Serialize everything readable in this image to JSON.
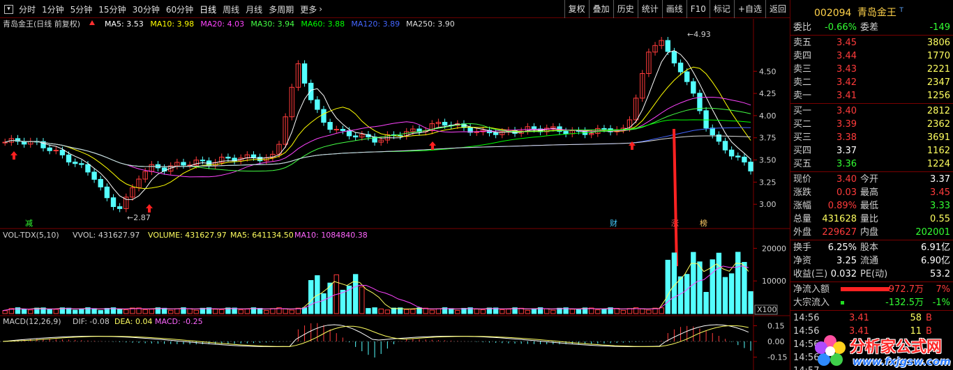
{
  "toolbar": {
    "periods": [
      "分时",
      "1分钟",
      "5分钟",
      "15分钟",
      "30分钟",
      "60分钟",
      "日线",
      "周线",
      "月线",
      "多周期",
      "更多"
    ],
    "active_period": "日线",
    "more_arrow": "chevron-right-icon",
    "right_buttons": [
      "复权",
      "叠加",
      "历史",
      "统计",
      "画线",
      "F10",
      "标记",
      "+自选",
      "返回"
    ]
  },
  "price_pane": {
    "title": "青岛金王(日线 前复权)",
    "ma": [
      {
        "label": "MA5: 3.53",
        "color": "#ffffff"
      },
      {
        "label": "MA10: 3.98",
        "color": "#ffff00"
      },
      {
        "label": "MA20: 4.03",
        "color": "#ff44ff"
      },
      {
        "label": "MA30: 3.94",
        "color": "#44ff44"
      },
      {
        "label": "MA60: 3.88",
        "color": "#00ff00"
      },
      {
        "label": "MA120: 3.89",
        "color": "#4466ff"
      },
      {
        "label": "MA250: 3.90",
        "color": "#dddddd"
      }
    ],
    "y_ticks": [
      "4.50",
      "4.25",
      "4.00",
      "3.75",
      "3.50",
      "3.25",
      "3.00"
    ],
    "high_label": "4.93",
    "low_label": "2.87",
    "markers": [
      "减",
      "财",
      "涨",
      "榜"
    ]
  },
  "vol_pane": {
    "title": "VOL-TDX(5,10)",
    "vvol": "VVOL: 431627.97",
    "volume": "VOLUME: 431627.97",
    "ma5": "MA5: 641134.50",
    "ma10": "MA10: 1084840.38",
    "y_ticks": [
      "20000",
      "10000"
    ],
    "unit": "X100"
  },
  "macd_pane": {
    "title": "MACD(12,26,9)",
    "dif": "DIF: -0.08",
    "dea": "DEA: 0.04",
    "macd": "MACD: -0.25",
    "y_ticks": [
      "0.15",
      "0.00",
      "-0.15"
    ]
  },
  "quote": {
    "code": "002094",
    "name": "青岛金王",
    "sup": "T",
    "weibi": {
      "label": "委比",
      "value": "-0.66%",
      "label2": "委差",
      "value2": "-149"
    },
    "asks": [
      {
        "label": "卖五",
        "price": "3.45",
        "vol": "3806"
      },
      {
        "label": "卖四",
        "price": "3.44",
        "vol": "1770"
      },
      {
        "label": "卖三",
        "price": "3.43",
        "vol": "2221"
      },
      {
        "label": "卖二",
        "price": "3.42",
        "vol": "2347"
      },
      {
        "label": "卖一",
        "price": "3.41",
        "vol": "1256"
      }
    ],
    "bids": [
      {
        "label": "买一",
        "price": "3.40",
        "vol": "2812",
        "color": "red"
      },
      {
        "label": "买二",
        "price": "3.39",
        "vol": "2362",
        "color": "red"
      },
      {
        "label": "买三",
        "price": "3.38",
        "vol": "3691",
        "color": "red"
      },
      {
        "label": "买四",
        "price": "3.37",
        "vol": "1162",
        "color": "white"
      },
      {
        "label": "买五",
        "price": "3.36",
        "vol": "1224",
        "color": "green"
      }
    ],
    "stats": [
      {
        "l1": "现价",
        "v1": "3.40",
        "c1": "red",
        "l2": "今开",
        "v2": "3.37",
        "c2": "white"
      },
      {
        "l1": "涨跌",
        "v1": "0.03",
        "c1": "red",
        "l2": "最高",
        "v2": "3.45",
        "c2": "red"
      },
      {
        "l1": "涨幅",
        "v1": "0.89%",
        "c1": "red",
        "l2": "最低",
        "v2": "3.33",
        "c2": "green"
      },
      {
        "l1": "总量",
        "v1": "431628",
        "c1": "yellow",
        "l2": "量比",
        "v2": "0.55",
        "c2": "yellow"
      },
      {
        "l1": "外盘",
        "v1": "229627",
        "c1": "red",
        "l2": "内盘",
        "v2": "202001",
        "c2": "green"
      }
    ],
    "stats2": [
      {
        "l1": "换手",
        "v1": "6.25%",
        "c1": "white",
        "l2": "股本",
        "v2": "6.91亿",
        "c2": "white"
      },
      {
        "l1": "净资",
        "v1": "3.25",
        "c1": "white",
        "l2": "流通",
        "v2": "6.90亿",
        "c2": "white"
      },
      {
        "l1": "收益(三)",
        "v1": "0.032",
        "c1": "white",
        "l2": "PE(动)",
        "v2": "53.2",
        "c2": "white"
      }
    ],
    "flows": [
      {
        "label": "净流入额",
        "value": "972.7万",
        "pct": "7%",
        "color": "red",
        "fill": 1.0
      },
      {
        "label": "大宗流入",
        "value": "-132.5万",
        "pct": "-1%",
        "color": "green",
        "fill": 0.07
      }
    ],
    "ticks": [
      {
        "time": "14:56",
        "price": "3.41",
        "vol": "58",
        "side": "B"
      },
      {
        "time": "14:56",
        "price": "3.41",
        "vol": "11",
        "side": "B"
      },
      {
        "time": "14:56",
        "price": "3.41",
        "vol": "",
        "side": ""
      },
      {
        "time": "14:56",
        "price": "",
        "vol": "",
        "side": ""
      },
      {
        "time": "14:57",
        "price": "",
        "vol": "",
        "side": ""
      }
    ]
  },
  "watermark": {
    "cn": "分析家公式网",
    "url": "www.fxjgsw.com"
  },
  "colors": {
    "up": "#ff3b3b",
    "down": "#54ffff",
    "axis": "#7a0000",
    "grid": "#5a0000"
  }
}
